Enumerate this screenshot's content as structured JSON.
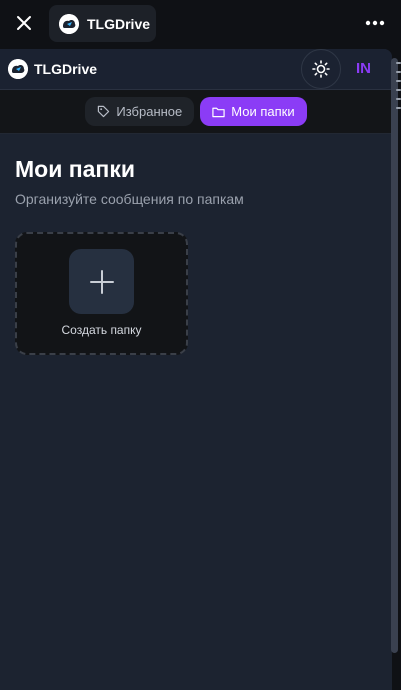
{
  "chrome": {
    "app_title": "TLGDrive"
  },
  "header": {
    "brand": "TLGDrive",
    "language": "IN"
  },
  "tabs": [
    {
      "label": "Избранное",
      "icon": "tag-icon",
      "active": false
    },
    {
      "label": "Мои папки",
      "icon": "folder-icon",
      "active": true
    }
  ],
  "main": {
    "title": "Мои папки",
    "subtitle": "Организуйте сообщения по папкам",
    "create_label": "Создать папку"
  },
  "colors": {
    "accent": "#8b3cf6",
    "background": "#1c2330",
    "card": "#121417"
  }
}
